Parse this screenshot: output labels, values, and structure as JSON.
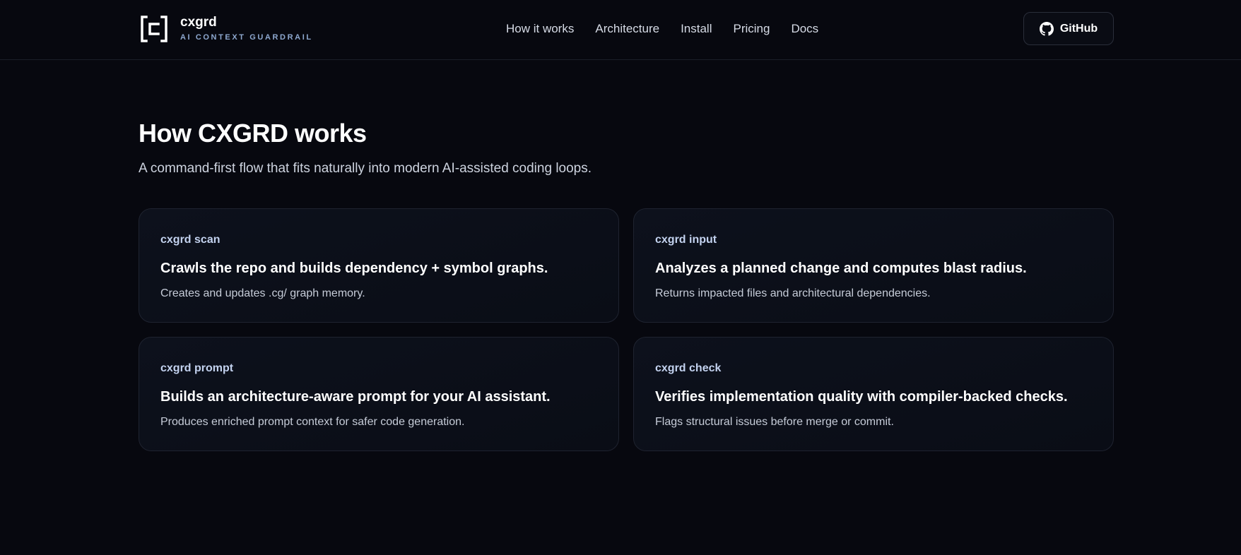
{
  "brand": {
    "name": "cxgrd",
    "tagline": "AI CONTEXT GUARDRAIL",
    "logo_icon": "bracket-c-logo"
  },
  "nav": {
    "links": [
      "How it works",
      "Architecture",
      "Install",
      "Pricing",
      "Docs"
    ],
    "github_label": "GitHub",
    "github_icon": "github-icon"
  },
  "section": {
    "title": "How CXGRD works",
    "subtitle": "A command-first flow that fits naturally into modern AI-assisted coding loops."
  },
  "cards": [
    {
      "command": "cxgrd scan",
      "title": "Crawls the repo and builds dependency + symbol graphs.",
      "description": "Creates and updates .cg/ graph memory."
    },
    {
      "command": "cxgrd input",
      "title": "Analyzes a planned change and computes blast radius.",
      "description": "Returns impacted files and architectural dependencies."
    },
    {
      "command": "cxgrd prompt",
      "title": "Builds an architecture-aware prompt for your AI assistant.",
      "description": "Produces enriched prompt context for safer code generation."
    },
    {
      "command": "cxgrd check",
      "title": "Verifies implementation quality with compiler-backed checks.",
      "description": "Flags structural issues before merge or commit."
    }
  ],
  "colors": {
    "background": "#07080f",
    "card_background": "#0c101a",
    "card_border": "#1f2330",
    "command_accent": "#c3d2ef",
    "tagline": "#8ea8cf"
  }
}
